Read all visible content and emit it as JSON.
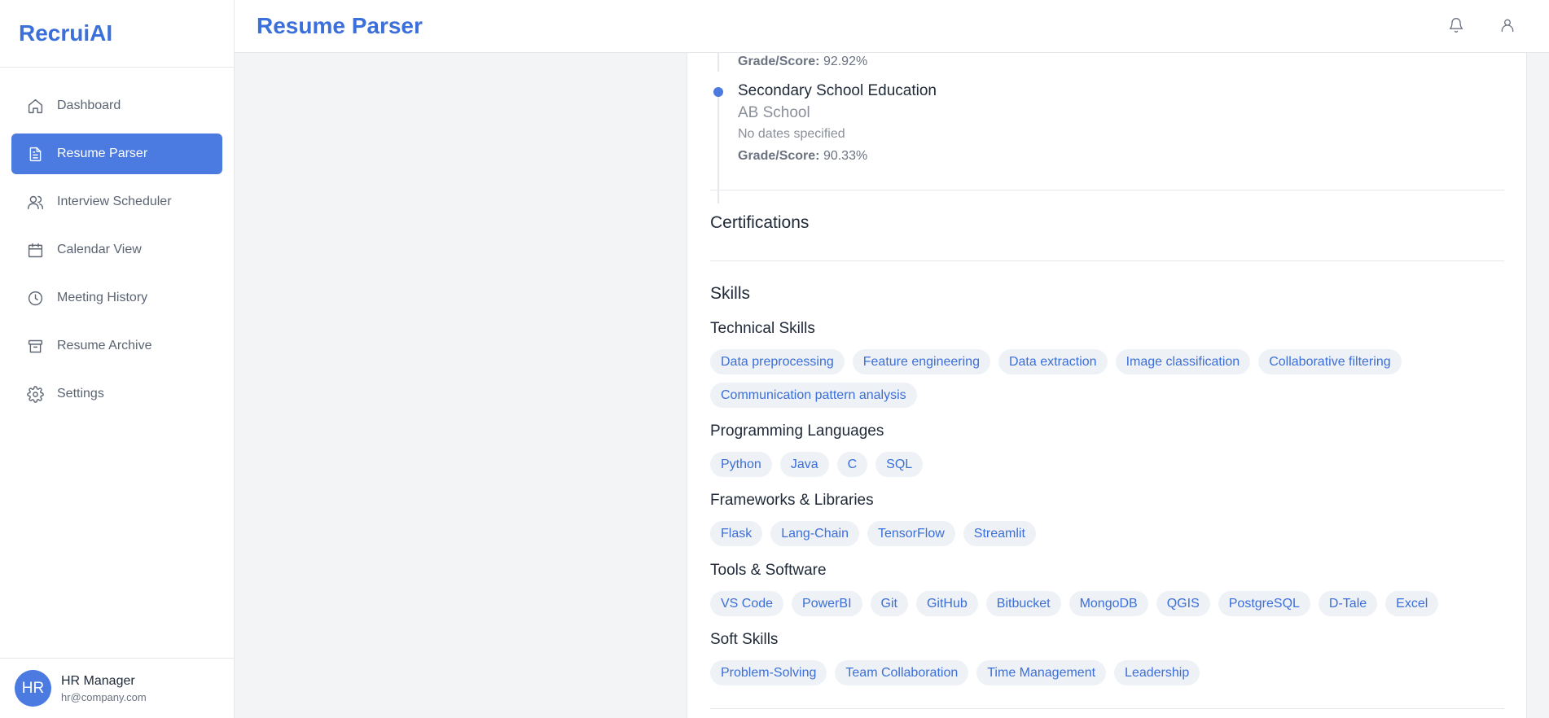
{
  "brand": "RecruiAI",
  "header": {
    "title": "Resume Parser"
  },
  "sidebar": {
    "items": [
      {
        "label": "Dashboard",
        "icon": "home-icon"
      },
      {
        "label": "Resume Parser",
        "icon": "document-icon",
        "active": true
      },
      {
        "label": "Interview Scheduler",
        "icon": "users-icon"
      },
      {
        "label": "Calendar View",
        "icon": "calendar-icon"
      },
      {
        "label": "Meeting History",
        "icon": "clock-icon"
      },
      {
        "label": "Resume Archive",
        "icon": "archive-icon"
      },
      {
        "label": "Settings",
        "icon": "gear-icon"
      }
    ]
  },
  "user": {
    "initials": "HR",
    "name": "HR Manager",
    "email": "hr@company.com"
  },
  "education": {
    "prev_grade_label": "Grade/Score:",
    "prev_grade_value": "92.92%",
    "entry": {
      "title": "Secondary School Education",
      "school": "AB School",
      "dates": "No dates specified",
      "grade_label": "Grade/Score:",
      "grade_value": "90.33%"
    }
  },
  "certifications": {
    "title": "Certifications"
  },
  "skills": {
    "title": "Skills",
    "technical": {
      "title": "Technical Skills",
      "items": [
        "Data preprocessing",
        "Feature engineering",
        "Data extraction",
        "Image classification",
        "Collaborative filtering",
        "Communication pattern analysis"
      ]
    },
    "programming": {
      "title": "Programming Languages",
      "items": [
        "Python",
        "Java",
        "C",
        "SQL"
      ]
    },
    "frameworks": {
      "title": "Frameworks & Libraries",
      "items": [
        "Flask",
        "Lang-Chain",
        "TensorFlow",
        "Streamlit"
      ]
    },
    "tools": {
      "title": "Tools & Software",
      "items": [
        "VS Code",
        "PowerBI",
        "Git",
        "GitHub",
        "Bitbucket",
        "MongoDB",
        "QGIS",
        "PostgreSQL",
        "D-Tale",
        "Excel"
      ]
    },
    "soft": {
      "title": "Soft Skills",
      "items": [
        "Problem-Solving",
        "Team Collaboration",
        "Time Management",
        "Leadership"
      ]
    }
  },
  "colors": {
    "accent": "#4b7ae0",
    "brand": "#3b6fd9",
    "tag_bg": "#eef1f5"
  }
}
